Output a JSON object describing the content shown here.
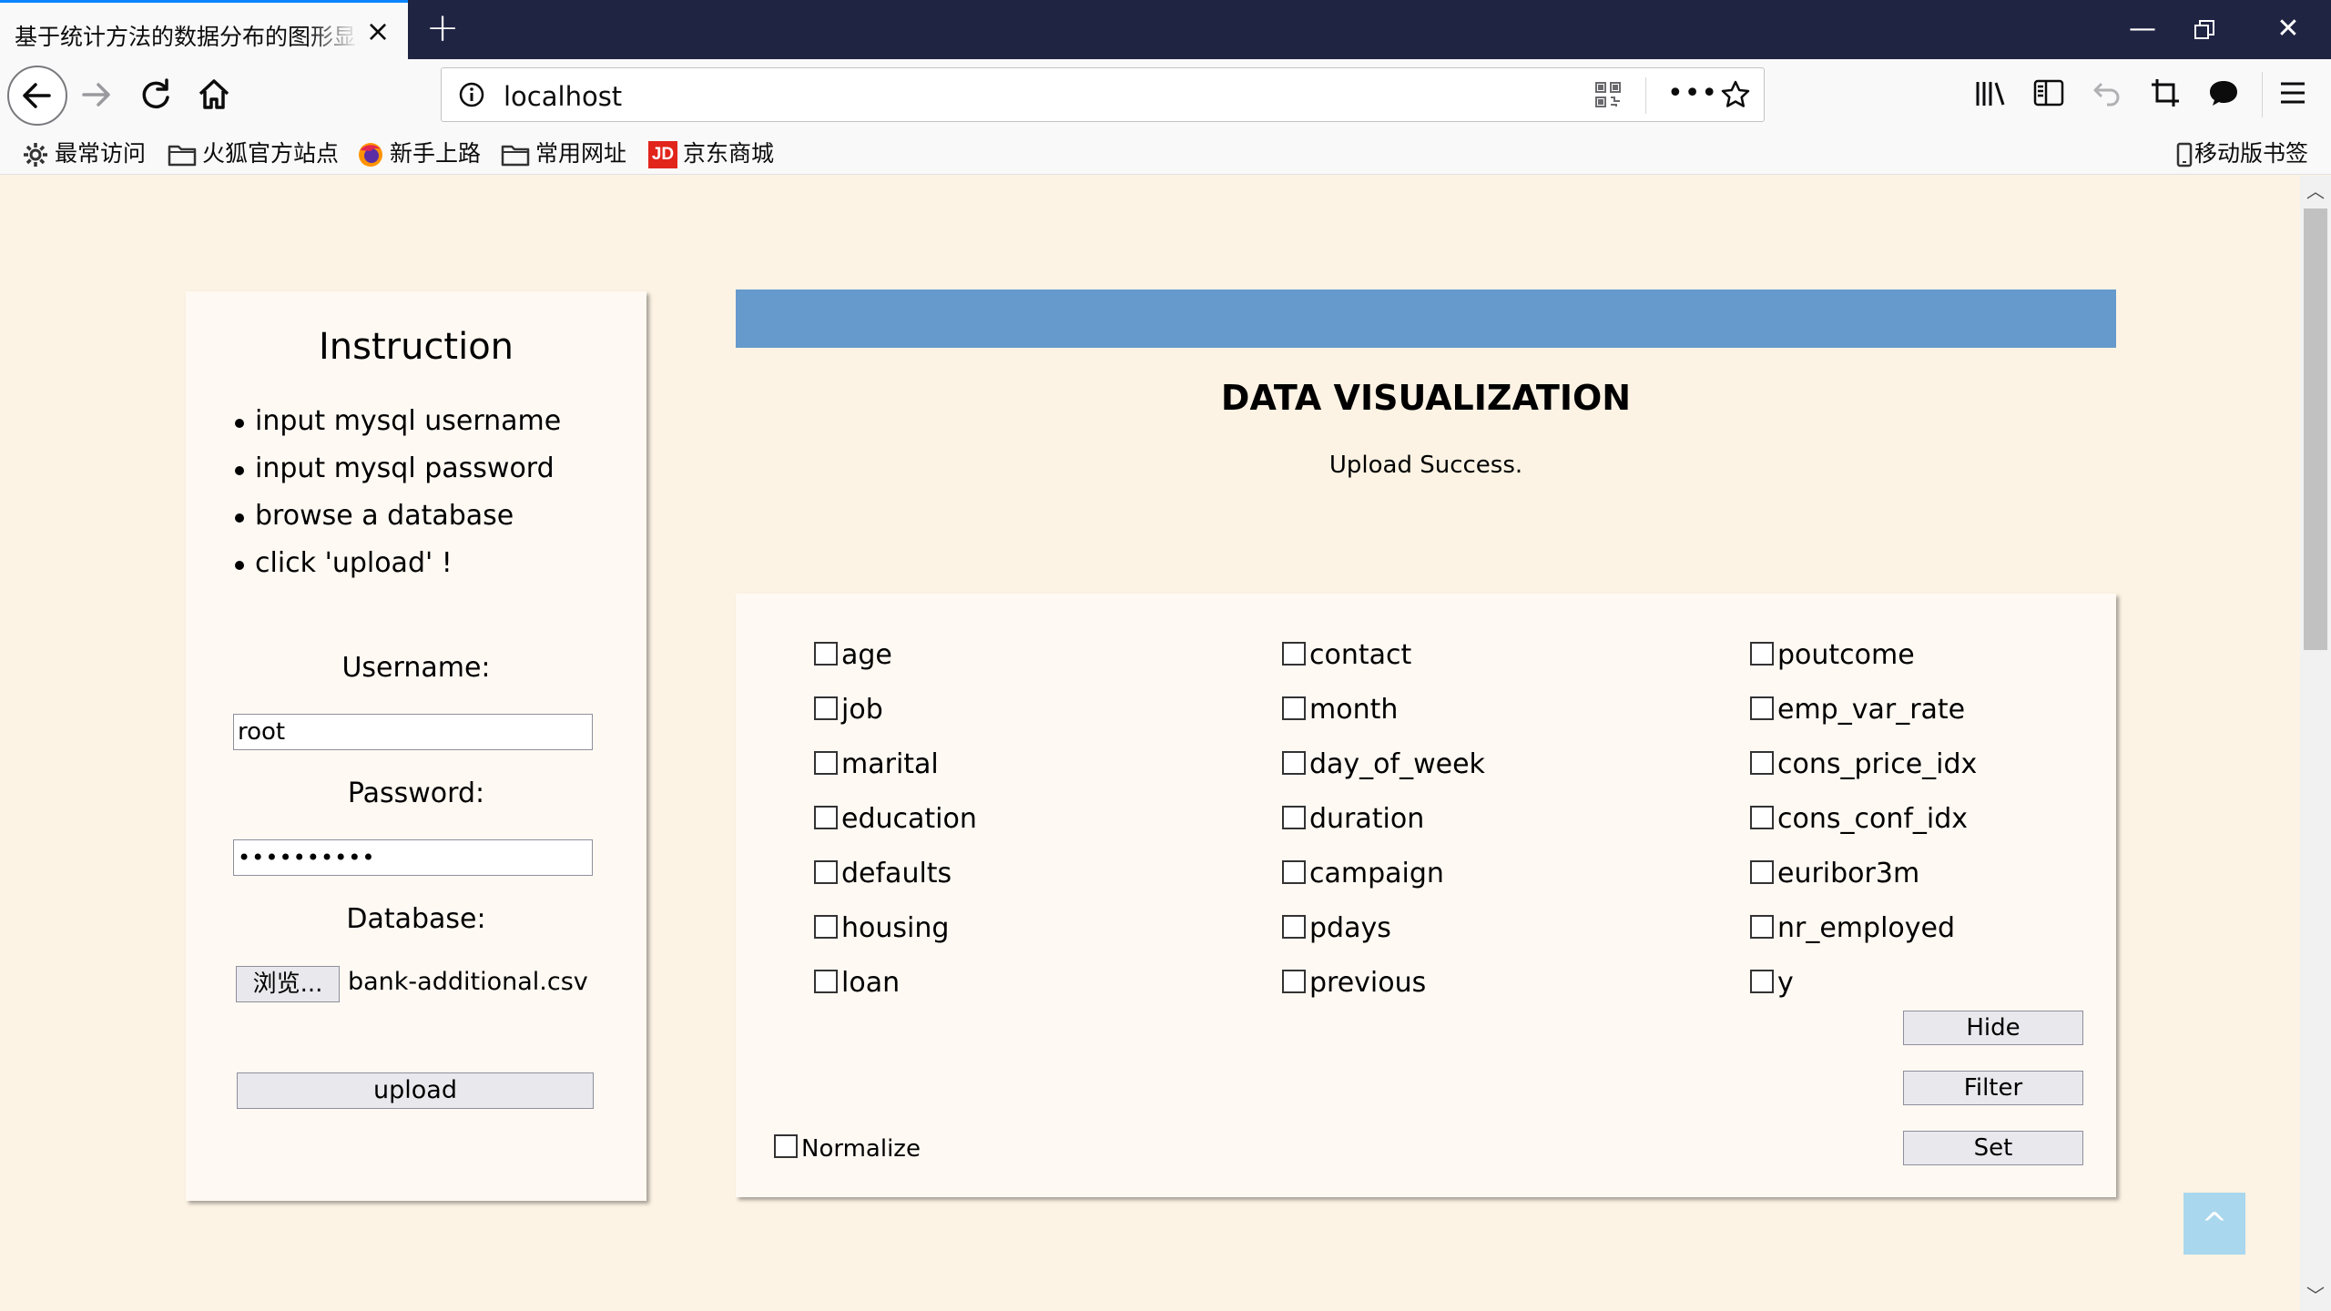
{
  "browser": {
    "tab_title": "基于统计方法的数据分布的图形显示",
    "url": "localhost",
    "bookmarks": [
      "最常访问",
      "火狐官方站点",
      "新手上路",
      "常用网址",
      "京东商城"
    ],
    "mobile_bookmarks": "移动版书签",
    "icons": [
      "back-icon",
      "forward-icon",
      "reload-icon",
      "home-icon",
      "info-icon",
      "qr-code-icon",
      "more-icon",
      "star-icon",
      "library-icon",
      "sidebar-icon",
      "undo-icon",
      "crop-icon",
      "chat-icon",
      "menu-icon"
    ]
  },
  "instruction": {
    "title": "Instruction",
    "steps": [
      "input mysql username",
      "input mysql password",
      "browse a database",
      "click 'upload' !"
    ]
  },
  "form": {
    "username_label": "Username:",
    "username_value": "root",
    "password_label": "Password:",
    "password_mask": "••••••••••",
    "database_label": "Database:",
    "browse_label": "浏览...",
    "file_name": "bank-additional.csv",
    "upload_label": "upload"
  },
  "main": {
    "title": "DATA VISUALIZATION",
    "status": "Upload Success."
  },
  "fields": {
    "col1": [
      "age",
      "job",
      "marital",
      "education",
      "defaults",
      "housing",
      "loan"
    ],
    "col2": [
      "contact",
      "month",
      "day_of_week",
      "duration",
      "campaign",
      "pdays",
      "previous"
    ],
    "col3": [
      "poutcome",
      "emp_var_rate",
      "cons_price_idx",
      "cons_conf_idx",
      "euribor3m",
      "nr_employed",
      "y"
    ]
  },
  "actions": {
    "hide": "Hide",
    "filter": "Filter",
    "set": "Set",
    "normalize": "Normalize"
  },
  "back_to_top": "^",
  "colors": {
    "page_bg": "#fcf3e4",
    "banner": "#6699cc",
    "tabbar": "#202443",
    "to_top": "#a9d7ee"
  }
}
